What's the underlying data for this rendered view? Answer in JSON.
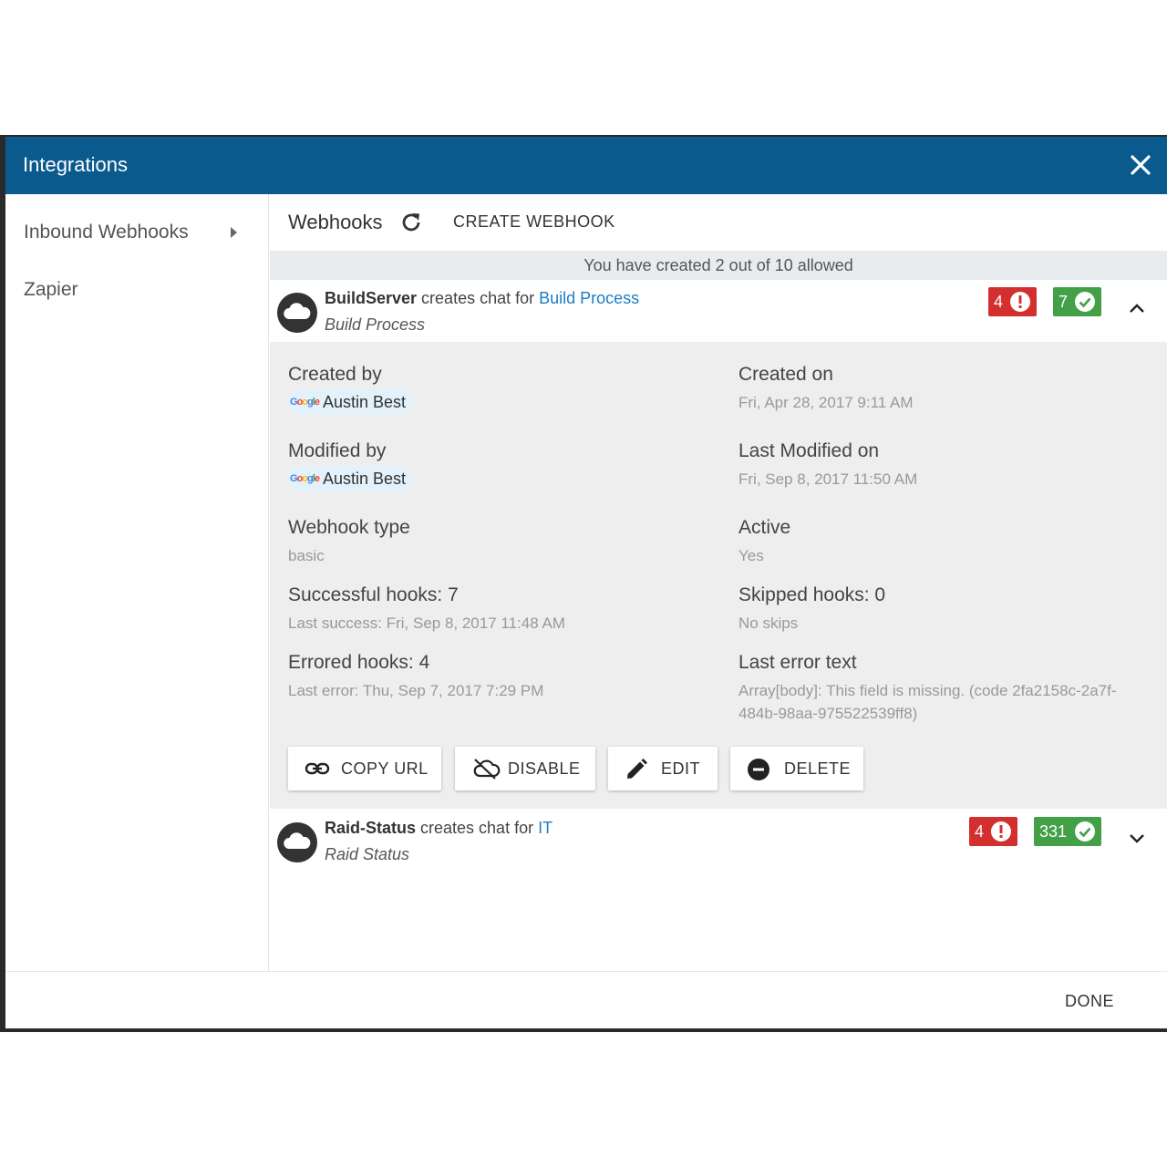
{
  "dialog": {
    "title": "Integrations"
  },
  "sidebar": {
    "items": [
      {
        "label": "Inbound Webhooks"
      },
      {
        "label": "Zapier"
      }
    ]
  },
  "toolbar": {
    "title": "Webhooks",
    "create_label": "CREATE WEBHOOK"
  },
  "quota": {
    "text": "You have created 2 out of 10 allowed"
  },
  "webhooks": [
    {
      "source": "BuildServer",
      "verb": " creates chat for ",
      "target": "Build Process",
      "name": "Build Process",
      "errors": "4",
      "successes": "7",
      "details": {
        "created_by_label": "Created by",
        "created_by_user": "Austin Best",
        "created_on_label": "Created on",
        "created_on_value": "Fri, Apr 28, 2017 9:11 AM",
        "modified_by_label": "Modified by",
        "modified_by_user": "Austin Best",
        "modified_on_label": "Last Modified on",
        "modified_on_value": "Fri, Sep 8, 2017 11:50 AM",
        "type_label": "Webhook type",
        "type_value": "basic",
        "active_label": "Active",
        "active_value": "Yes",
        "success_label": "Successful hooks: 7",
        "success_value": "Last success: Fri, Sep 8, 2017 11:48 AM",
        "skipped_label": "Skipped hooks: 0",
        "skipped_value": "No skips",
        "errored_label": "Errored hooks: 4",
        "errored_value": "Last error: Thu, Sep 7, 2017 7:29 PM",
        "error_text_label": "Last error text",
        "error_text_value": "Array[body]: This field is missing. (code 2fa2158c-2a7f-484b-98aa-975522539ff8)"
      },
      "actions": {
        "copy_url": "COPY URL",
        "disable": "DISABLE",
        "edit": "EDIT",
        "delete": "DELETE"
      }
    },
    {
      "source": "Raid-Status",
      "verb": " creates chat for ",
      "target": "IT",
      "name": "Raid Status",
      "errors": "4",
      "successes": "331"
    }
  ],
  "footer": {
    "done_label": "DONE"
  },
  "colors": {
    "header": "#0b5a8e",
    "error": "#d32f2f",
    "success": "#43a047",
    "link": "#1e7dc4"
  }
}
